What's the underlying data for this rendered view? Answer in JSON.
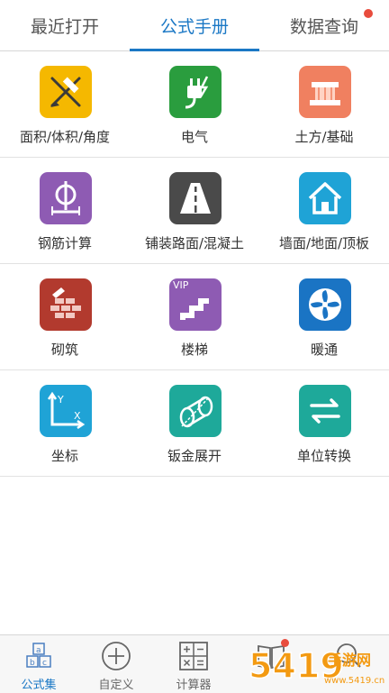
{
  "tabs": [
    {
      "label": "最近打开",
      "active": false
    },
    {
      "label": "公式手册",
      "active": true
    },
    {
      "label": "数据查询",
      "active": false,
      "badge": true
    }
  ],
  "grid": [
    {
      "label": "面积/体积/角度",
      "icon": "ruler-pencil-icon",
      "color": "#f5b800"
    },
    {
      "label": "电气",
      "icon": "electric-plug-icon",
      "color": "#2a9d3e"
    },
    {
      "label": "土方/基础",
      "icon": "foundation-icon",
      "color": "#f08060"
    },
    {
      "label": "钢筋计算",
      "icon": "rebar-icon",
      "color": "#8e5bb3"
    },
    {
      "label": "铺装路面/混凝土",
      "icon": "road-icon",
      "color": "#4a4a4a"
    },
    {
      "label": "墙面/地面/顶板",
      "icon": "house-icon",
      "color": "#1fa3d6"
    },
    {
      "label": "砌筑",
      "icon": "brick-wall-icon",
      "color": "#b23a2e"
    },
    {
      "label": "楼梯",
      "icon": "stairs-icon",
      "color": "#8e5bb3",
      "tag": "VIP"
    },
    {
      "label": "暖通",
      "icon": "fan-icon",
      "color": "#1a74c4"
    },
    {
      "label": "坐标",
      "icon": "axis-icon",
      "color": "#1fa3d6",
      "axis_x": "X",
      "axis_y": "Y"
    },
    {
      "label": "钣金展开",
      "icon": "sheet-metal-icon",
      "color": "#1ea99a"
    },
    {
      "label": "单位转换",
      "icon": "convert-arrows-icon",
      "color": "#1ea99a"
    }
  ],
  "bottom_nav": [
    {
      "label": "公式集",
      "icon": "formula-set-icon",
      "active": true,
      "letters": [
        "a",
        "b",
        "c"
      ]
    },
    {
      "label": "自定义",
      "icon": "plus-circle-icon",
      "active": false
    },
    {
      "label": "计算器",
      "icon": "calculator-icon",
      "active": false
    },
    {
      "label": "",
      "icon": "book-icon",
      "active": false,
      "badge": true
    },
    {
      "label": "",
      "icon": "search-icon",
      "active": false
    }
  ],
  "watermark": {
    "text": "手游网",
    "number": "5419",
    "domain": "www.5419.cn"
  },
  "colors": {
    "accent": "#1b78c5",
    "badge": "#e84c3d"
  }
}
